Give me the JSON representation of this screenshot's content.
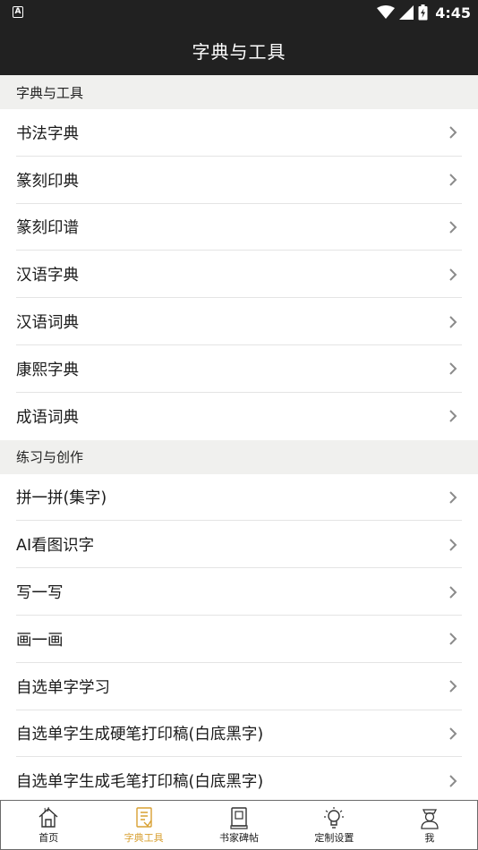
{
  "status_bar": {
    "left_icon": "A",
    "time": "4:45"
  },
  "app_bar": {
    "title": "字典与工具"
  },
  "sections": [
    {
      "header": "字典与工具",
      "items": [
        "书法字典",
        "篆刻印典",
        "篆刻印谱",
        "汉语字典",
        "汉语词典",
        "康熙字典",
        "成语词典"
      ]
    },
    {
      "header": "练习与创作",
      "items": [
        "拼一拼(集字)",
        "AI看图识字",
        "写一写",
        "画一画",
        "自选单字学习",
        "自选单字生成硬笔打印稿(白底黑字)",
        "自选单字生成毛笔打印稿(白底黑字)"
      ]
    }
  ],
  "bottom_nav": {
    "active_color": "#d8a032",
    "items": [
      {
        "label": "首页",
        "icon": "home-icon"
      },
      {
        "label": "字典工具",
        "icon": "dictionary-icon"
      },
      {
        "label": "书家碑帖",
        "icon": "book-icon"
      },
      {
        "label": "定制设置",
        "icon": "settings-bulb-icon"
      },
      {
        "label": "我",
        "icon": "profile-icon"
      }
    ]
  }
}
